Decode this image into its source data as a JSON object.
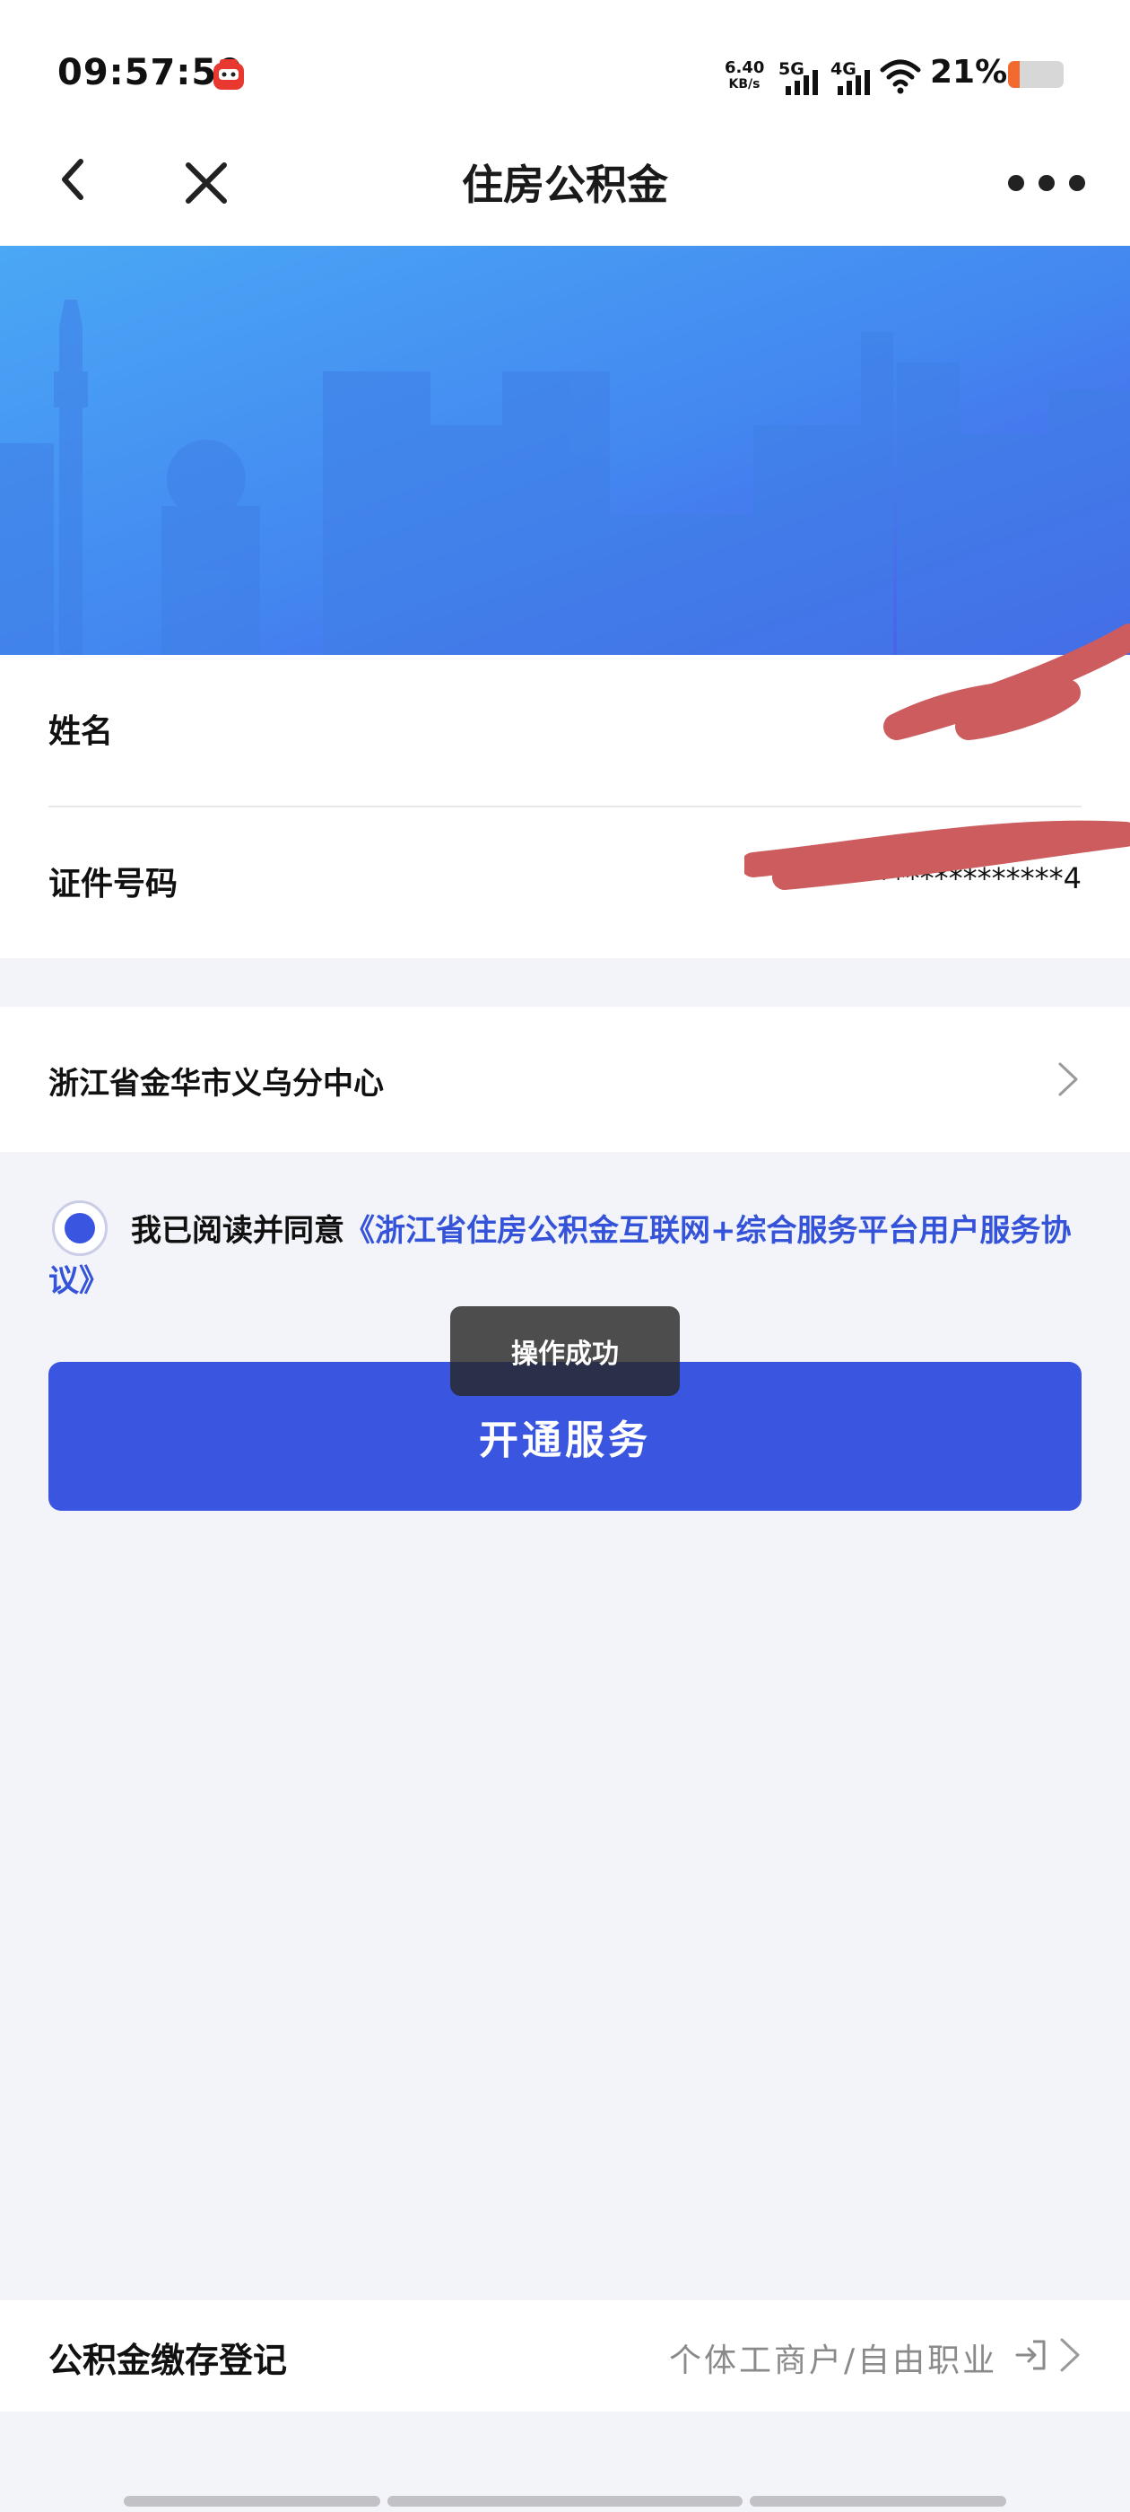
{
  "status_bar": {
    "time": "09:57:50",
    "net_speed_value": "6.40",
    "net_speed_unit": "KB/s",
    "signal_1_label": "5G",
    "signal_2_label": "4G",
    "battery_percent": "21%",
    "battery_level": 0.21,
    "battery_color": "#f26a2e"
  },
  "nav": {
    "title": "住房公积金"
  },
  "info": {
    "name_label": "姓名",
    "id_label": "证件号码",
    "id_value": "****************4"
  },
  "center": {
    "label": "浙江省金华市义乌分中心"
  },
  "agreement": {
    "checked": true,
    "prefix": "我已阅读并同意",
    "link": "《浙江省住房公积金互联网+综合服务平台用户服务协议》"
  },
  "actions": {
    "open_service": "开通服务"
  },
  "toast": {
    "message": "操作成功"
  },
  "bottom": {
    "label": "公积金缴存登记",
    "right_text": "个体工商户/自由职业"
  },
  "colors": {
    "primary": "#3a55e0",
    "link": "#3553d9",
    "background": "#f2f4f9",
    "banner_start": "#4aa8f5",
    "banner_end": "#4b5ae8"
  }
}
